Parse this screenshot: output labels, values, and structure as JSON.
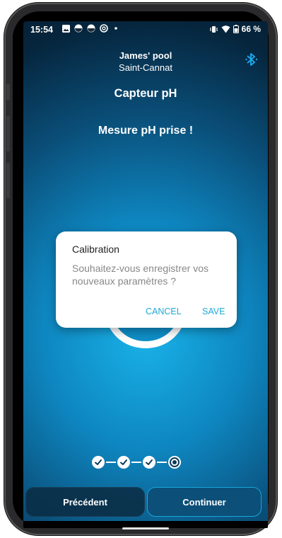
{
  "status_bar": {
    "time": "15:54",
    "battery": "66 %",
    "icons": [
      "gallery-icon",
      "pool-app-icon",
      "pool-app-icon",
      "at-sign-icon",
      "dot-icon",
      "vibrate-icon",
      "wifi-icon",
      "battery-icon"
    ]
  },
  "header": {
    "pool_name": "James' pool",
    "location": "Saint-Cannat",
    "bluetooth_icon": "bluetooth-icon"
  },
  "page": {
    "title": "Capteur pH",
    "message": "Mesure pH prise !"
  },
  "dialog": {
    "title": "Calibration",
    "message": "Souhaitez-vous enregistrer vos nouveaux paramètres ?",
    "cancel_label": "CANCEL",
    "save_label": "SAVE"
  },
  "stepper": {
    "total_steps": 4,
    "completed_steps": 3,
    "current_step": 4
  },
  "footer": {
    "prev_label": "Précédent",
    "next_label": "Continuer"
  },
  "colors": {
    "accent": "#1fa9d6",
    "background_center": "#19b2e8",
    "background_edge": "#041a2c"
  }
}
